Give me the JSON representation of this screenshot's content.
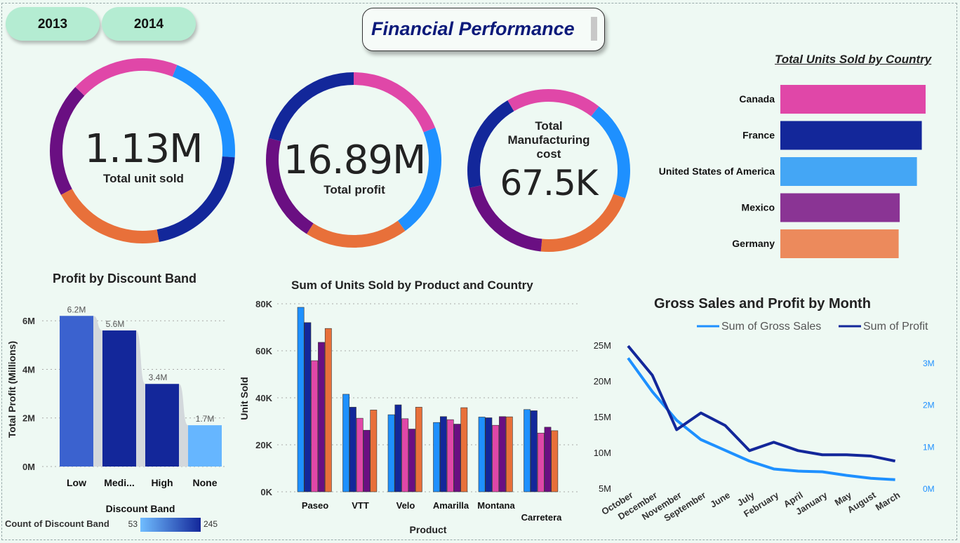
{
  "filters": {
    "year_2013": "2013",
    "year_2014": "2014"
  },
  "header": {
    "title": "Financial Performance"
  },
  "kpis": {
    "units": {
      "value": "1.13M",
      "label": "Total unit sold"
    },
    "profit": {
      "value": "16.89M",
      "label": "Total profit"
    },
    "mfg": {
      "label": "Total Manufacturing cost",
      "value": "67.5K"
    }
  },
  "colors": {
    "pink": "#e047a8",
    "blue": "#1e90ff",
    "navy": "#13279a",
    "purple": "#6a0f82",
    "orange": "#e8703a",
    "lightblue": "#44a6f5",
    "violet": "#8a3494",
    "salmon": "#ec8a5c"
  },
  "country_chart": {
    "title": "Total Units Sold by Country",
    "type": "bar",
    "categories": [
      "Canada",
      "France",
      "United States of America",
      "Mexico",
      "Germany"
    ],
    "values": [
      247.4,
      240.9,
      232.6,
      203.3,
      201.5
    ]
  },
  "discount_chart": {
    "title": "Profit by Discount Band",
    "type": "bar",
    "categories": [
      "Low",
      "Medi...",
      "High",
      "None"
    ],
    "values": [
      6.2,
      5.6,
      3.4,
      1.7
    ],
    "data_labels": [
      "6.2M",
      "5.6M",
      "3.4M",
      "1.7M"
    ],
    "ylabel": "Total Profit (Millions)",
    "xlabel": "Discount Band",
    "yticks": [
      "0M",
      "2M",
      "4M",
      "6M"
    ],
    "legend": {
      "label": "Count of  Discount Band",
      "min": "53",
      "max": "245"
    }
  },
  "product_chart": {
    "title": "Sum of Units Sold by Product and Country",
    "type": "bar",
    "ylabel": "Unit Sold",
    "xlabel": "Product",
    "yticks": [
      "0K",
      "20K",
      "40K",
      "60K",
      "80K"
    ],
    "categories": [
      "Paseo",
      "VTT",
      "Velo",
      "Amarilla",
      "Montana",
      "Carretera"
    ],
    "series": [
      {
        "values": [
          78.5,
          41.5,
          32.8,
          29.5,
          31.8,
          35.0
        ]
      },
      {
        "values": [
          72.0,
          36.0,
          37.0,
          32.0,
          31.5,
          34.5
        ]
      },
      {
        "values": [
          55.8,
          31.3,
          31.1,
          30.7,
          28.3,
          25.0
        ]
      },
      {
        "values": [
          63.6,
          26.2,
          26.7,
          28.8,
          32.0,
          27.5
        ]
      },
      {
        "values": [
          69.5,
          34.8,
          36.0,
          35.8,
          31.9,
          26.0
        ]
      }
    ]
  },
  "month_chart": {
    "title": "Gross Sales and Profit by Month",
    "type": "line",
    "legend": [
      "Sum of  Gross Sales",
      "Sum of  Profit"
    ],
    "categories": [
      "October",
      "December",
      "November",
      "September",
      "June",
      "July",
      "February",
      "April",
      "January",
      "May",
      "August",
      "March"
    ],
    "left_ticks": [
      "5M",
      "10M",
      "15M",
      "20M",
      "25M"
    ],
    "right_ticks": [
      "0M",
      "1M",
      "2M",
      "3M"
    ],
    "gross_sales": [
      23.2,
      18.5,
      14.5,
      11.8,
      10.3,
      8.8,
      7.7,
      7.4,
      7.3,
      6.8,
      6.4,
      6.2
    ],
    "profit": [
      3.4,
      2.7,
      1.4,
      1.8,
      1.5,
      0.9,
      1.1,
      0.9,
      0.8,
      0.8,
      0.77,
      0.65
    ]
  }
}
